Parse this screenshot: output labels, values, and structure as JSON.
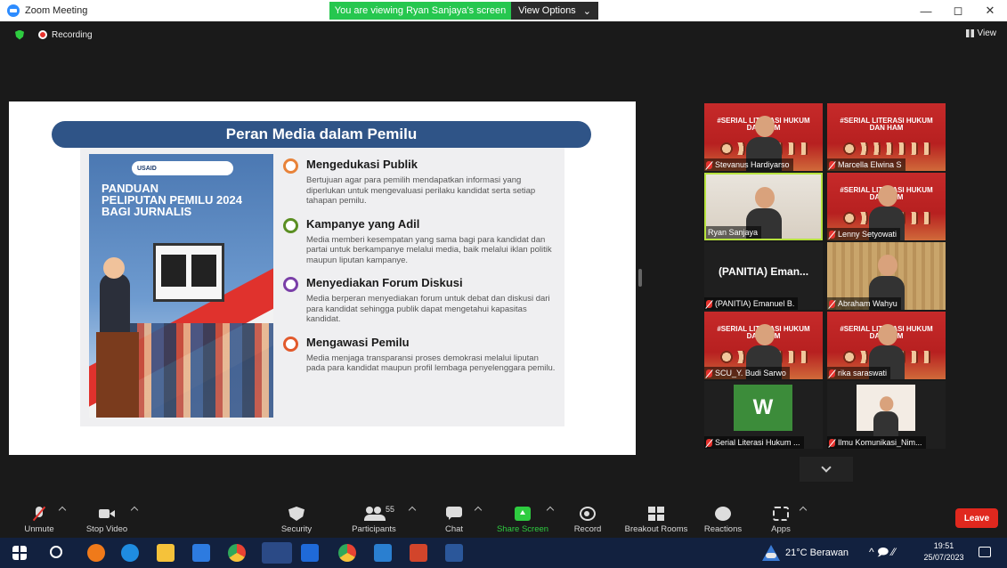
{
  "window": {
    "title": "Zoom Meeting",
    "viewing_banner": "You are viewing Ryan Sanjaya's screen",
    "view_options": "View Options",
    "minimize": "—",
    "maximize": "◻",
    "close": "✕"
  },
  "meeting": {
    "recording_label": "Recording",
    "view_label": "View"
  },
  "slide": {
    "header": "Peran Media dalam Pemilu",
    "poster": {
      "logos_text": "USAID",
      "title_lines": [
        "PANDUAN",
        "PELIPUTAN PEMILU 2024",
        "BAGI JURNALIS"
      ]
    },
    "points": [
      {
        "title": "Mengedukasi Publik",
        "desc": "Bertujuan agar para pemilih mendapatkan informasi yang diperlukan untuk mengevaluasi perilaku kandidat serta setiap tahapan pemilu.",
        "ring_color": "#e8833a"
      },
      {
        "title": "Kampanye yang Adil",
        "desc": "Media memberi kesempatan yang sama bagi para kandidat dan partai untuk berkampanye melalui media, baik melalui iklan politik maupun liputan kampanye.",
        "ring_color": "#5b8f23"
      },
      {
        "title": "Menyediakan Forum Diskusi",
        "desc": "Media berperan menyediakan forum untuk debat dan diskusi dari para kandidat sehingga publik dapat mengetahui kapasitas kandidat.",
        "ring_color": "#7a3fa8"
      },
      {
        "title": "Mengawasi Pemilu",
        "desc": "Media menjaga transparansi proses demokrasi melalui liputan pada para kandidat maupun profil lembaga penyelenggara pemilu.",
        "ring_color": "#e25a2c"
      }
    ]
  },
  "gallery": {
    "poster_header": "#SERIAL LITERASI HUKUM DAN HAM",
    "participants": [
      {
        "name": "Stevanus Hardiyarso",
        "muted": true,
        "bg": "poster",
        "person": true
      },
      {
        "name": "Marcella Elwina S",
        "muted": true,
        "bg": "poster",
        "person": false
      },
      {
        "name": "Ryan Sanjaya",
        "muted": false,
        "bg": "room",
        "person": true,
        "active": true
      },
      {
        "name": "Lenny Setyowati",
        "muted": true,
        "bg": "poster",
        "person": true
      },
      {
        "name": "(PANITIA) Emanuel B.",
        "muted": true,
        "bg": "dark",
        "person": false,
        "big_name": "(PANITIA) Eman..."
      },
      {
        "name": "Abraham Wahyu",
        "muted": true,
        "bg": "curtain",
        "person": true
      },
      {
        "name": "SCU_Y. Budi Sarwo",
        "muted": true,
        "bg": "poster",
        "person": true
      },
      {
        "name": "rika saraswati",
        "muted": true,
        "bg": "poster",
        "person": true
      },
      {
        "name": "Serial Literasi Hukum ...",
        "muted": true,
        "bg": "dark",
        "person": false,
        "avatar": "W"
      },
      {
        "name": "Ilmu Komunikasi_Nim...",
        "muted": true,
        "bg": "dark",
        "person": false,
        "thumb": true
      }
    ]
  },
  "toolbar": {
    "unmute": "Unmute",
    "stop_video": "Stop Video",
    "security": "Security",
    "participants": "Participants",
    "participants_count": "55",
    "chat": "Chat",
    "share_screen": "Share Screen",
    "record": "Record",
    "breakout_rooms": "Breakout Rooms",
    "reactions": "Reactions",
    "apps": "Apps",
    "leave": "Leave"
  },
  "taskbar": {
    "weather": "21°C  Berawan",
    "time": "19:51",
    "date": "25/07/2023",
    "tray_icons": "^  🗩  ⁄⁄"
  },
  "colors": {
    "slide_header_bg": "#2f5487",
    "share_green": "#2ecc40",
    "leave_red": "#e0281e",
    "active_speaker": "#b7e23e",
    "taskbar_bg": "#12213f"
  }
}
